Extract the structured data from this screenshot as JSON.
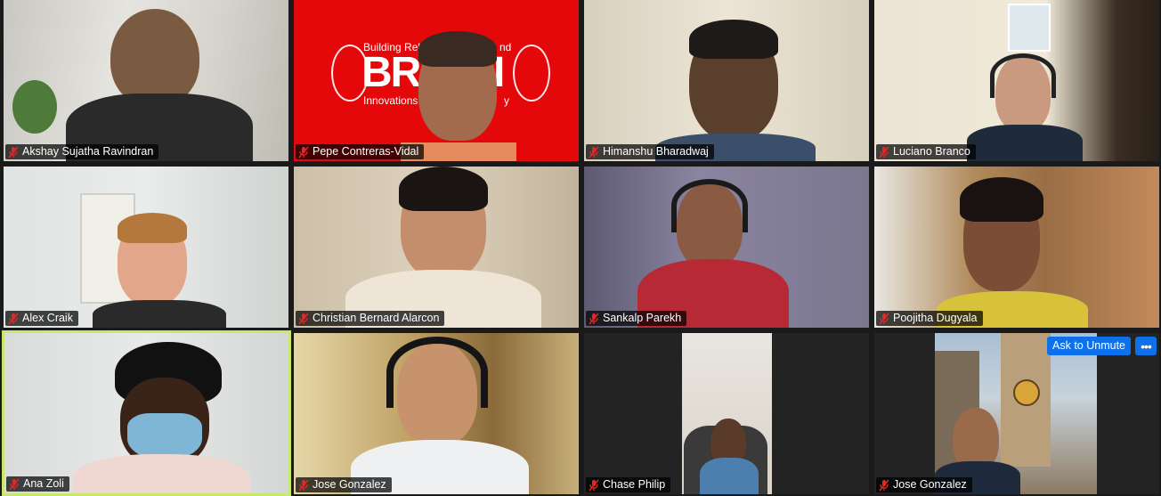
{
  "participants": [
    {
      "name": "Akshay Sujatha Ravindran",
      "muted": true
    },
    {
      "name": "Pepe Contreras-Vidal",
      "muted": true
    },
    {
      "name": "Himanshu Bharadwaj",
      "muted": true
    },
    {
      "name": "Luciano Branco",
      "muted": true
    },
    {
      "name": "Alex Craik",
      "muted": true
    },
    {
      "name": "Christian Bernard Alarcon",
      "muted": true
    },
    {
      "name": "Sankalp Parekh",
      "muted": true
    },
    {
      "name": "Poojitha Dugyala",
      "muted": true
    },
    {
      "name": "Ana Zoli",
      "muted": true,
      "active_speaker": true
    },
    {
      "name": "Jose Gonzalez",
      "muted": true
    },
    {
      "name": "Chase Philip",
      "muted": true
    },
    {
      "name": "Jose Gonzalez",
      "muted": true
    }
  ],
  "virtual_background": {
    "line1": "Building Reli",
    "line1_end": "nd",
    "logo": "BR",
    "logo_end": "I",
    "line2": "Innovations in",
    "line2_end": "y"
  },
  "controls": {
    "ask_to_unmute": "Ask to Unmute",
    "more": "•••"
  },
  "colors": {
    "active_border": "#c7e86a",
    "button_blue": "#0e71eb",
    "mic_red": "#e02828",
    "brain_red": "#e4080a"
  }
}
